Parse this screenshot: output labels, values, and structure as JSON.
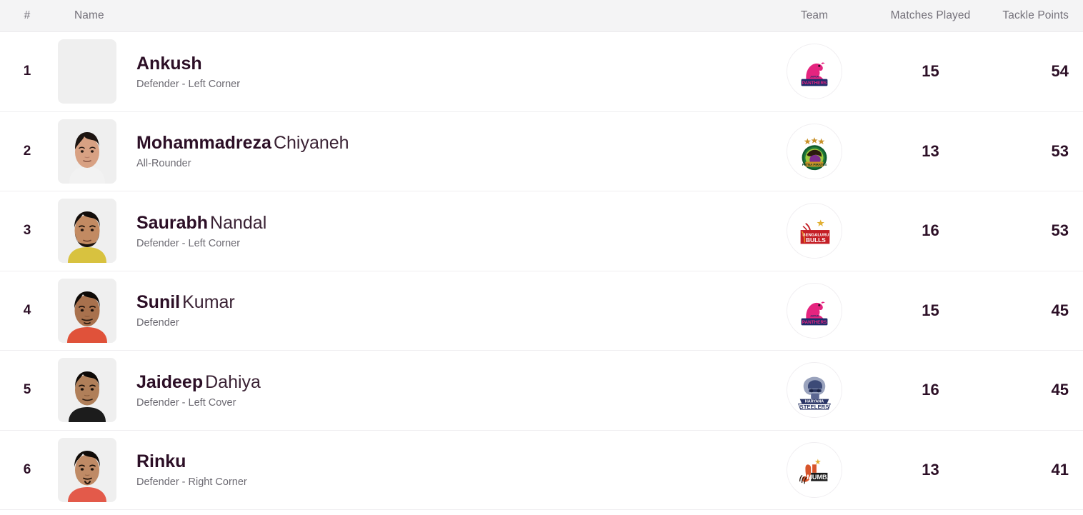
{
  "table": {
    "columns": {
      "rank": "#",
      "name": "Name",
      "team": "Team",
      "matches_played": "Matches Played",
      "tackle_points": "Tackle Points"
    },
    "rows": [
      {
        "rank": "1",
        "first_name": "Ankush",
        "last_name": "",
        "role": "Defender - Left Corner",
        "avatar": "player-photo-placeholder",
        "team_logo": "jaipur-pink-panthers-logo",
        "team_name": "Jaipur Pink Panthers",
        "matches_played": "15",
        "tackle_points": "54"
      },
      {
        "rank": "2",
        "first_name": "Mohammadreza",
        "last_name": "Chiyaneh",
        "role": "All-Rounder",
        "avatar": "player-photo",
        "team_logo": "patna-pirates-logo",
        "team_name": "Patna Pirates",
        "matches_played": "13",
        "tackle_points": "53"
      },
      {
        "rank": "3",
        "first_name": "Saurabh",
        "last_name": "Nandal",
        "role": "Defender - Left Corner",
        "avatar": "player-photo",
        "team_logo": "bengaluru-bulls-logo",
        "team_name": "Bengaluru Bulls",
        "matches_played": "16",
        "tackle_points": "53"
      },
      {
        "rank": "4",
        "first_name": "Sunil",
        "last_name": "Kumar",
        "role": "Defender",
        "avatar": "player-photo",
        "team_logo": "jaipur-pink-panthers-logo",
        "team_name": "Jaipur Pink Panthers",
        "matches_played": "15",
        "tackle_points": "45"
      },
      {
        "rank": "5",
        "first_name": "Jaideep",
        "last_name": "Dahiya",
        "role": "Defender - Left Cover",
        "avatar": "player-photo",
        "team_logo": "haryana-steelers-logo",
        "team_name": "Haryana Steelers",
        "matches_played": "16",
        "tackle_points": "45"
      },
      {
        "rank": "6",
        "first_name": "Rinku",
        "last_name": "",
        "role": "Defender - Right Corner",
        "avatar": "player-photo",
        "team_logo": "u-mumba-logo",
        "team_name": "U Mumba",
        "matches_played": "13",
        "tackle_points": "41"
      }
    ]
  },
  "colors": {
    "header_bg": "#f4f4f5",
    "header_text": "#74717a",
    "primary_text": "#2c0f26",
    "secondary_text": "#6c6a72",
    "row_divider": "#efeef0",
    "avatar_placeholder": "#efefef"
  }
}
